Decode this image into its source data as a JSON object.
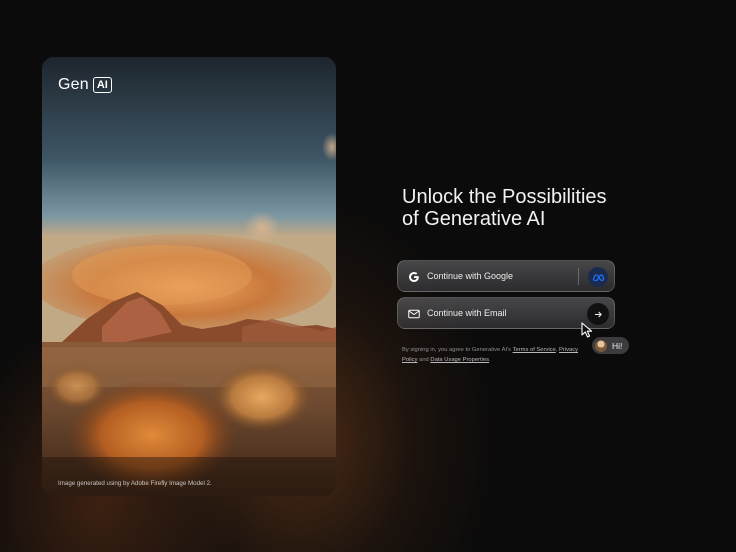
{
  "brand": {
    "word": "Gen",
    "box": "AI"
  },
  "hero": {
    "caption": "Image generated using by Adobe Firefly Image Model 2."
  },
  "headline": {
    "line1": "Unlock the Possibilities",
    "line2": "of Generative AI"
  },
  "auth": {
    "google_label": "Continue with Google",
    "google_icon": "google-g-icon",
    "meta_icon": "meta-logo-icon",
    "email_label": "Continue with Email",
    "email_icon": "envelope-icon",
    "arrow_icon": "arrow-right-icon"
  },
  "legal": {
    "prefix": "By signing in, you agree to Generative AI's",
    "terms": "Terms of Service",
    "comma": ",",
    "privacy": "Privacy Policy",
    "and": "and",
    "data": "Data Usage Properties",
    "period": "."
  },
  "chip": {
    "text": "Hi!"
  },
  "colors": {
    "background": "#0c0b0b",
    "button": "#5a5a5e",
    "meta_badge": "#1b2b4d",
    "meta_blue": "#1a73ff",
    "glow": "#82461e"
  }
}
